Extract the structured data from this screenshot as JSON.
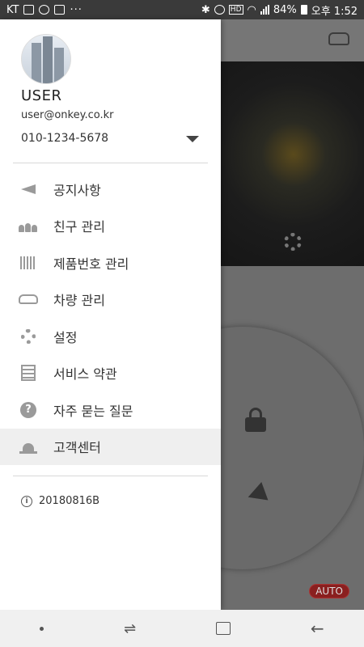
{
  "status_bar": {
    "carrier": "KT",
    "more": "···",
    "hd_label": "HD",
    "battery": "84%",
    "time": "오후 1:52"
  },
  "profile": {
    "name": "USER",
    "email": "user@onkey.co.kr",
    "phone": "010-1234-5678"
  },
  "menu": {
    "items": [
      {
        "label": "공지사항",
        "icon": "megaphone-icon"
      },
      {
        "label": "친구 관리",
        "icon": "friends-icon"
      },
      {
        "label": "제품번호 관리",
        "icon": "barcode-icon"
      },
      {
        "label": "차량 관리",
        "icon": "car-icon"
      },
      {
        "label": "설정",
        "icon": "gear-icon"
      },
      {
        "label": "서비스 약관",
        "icon": "document-icon"
      },
      {
        "label": "자주 묻는 질문",
        "icon": "question-icon"
      },
      {
        "label": "고객센터",
        "icon": "siren-icon"
      }
    ],
    "active_index": 7
  },
  "version": {
    "value": "20180816B"
  },
  "background_app": {
    "auto_badge": "AUTO"
  },
  "colors": {
    "icon_gray": "#9a9a9a",
    "badge_red": "#8a1f1f"
  }
}
